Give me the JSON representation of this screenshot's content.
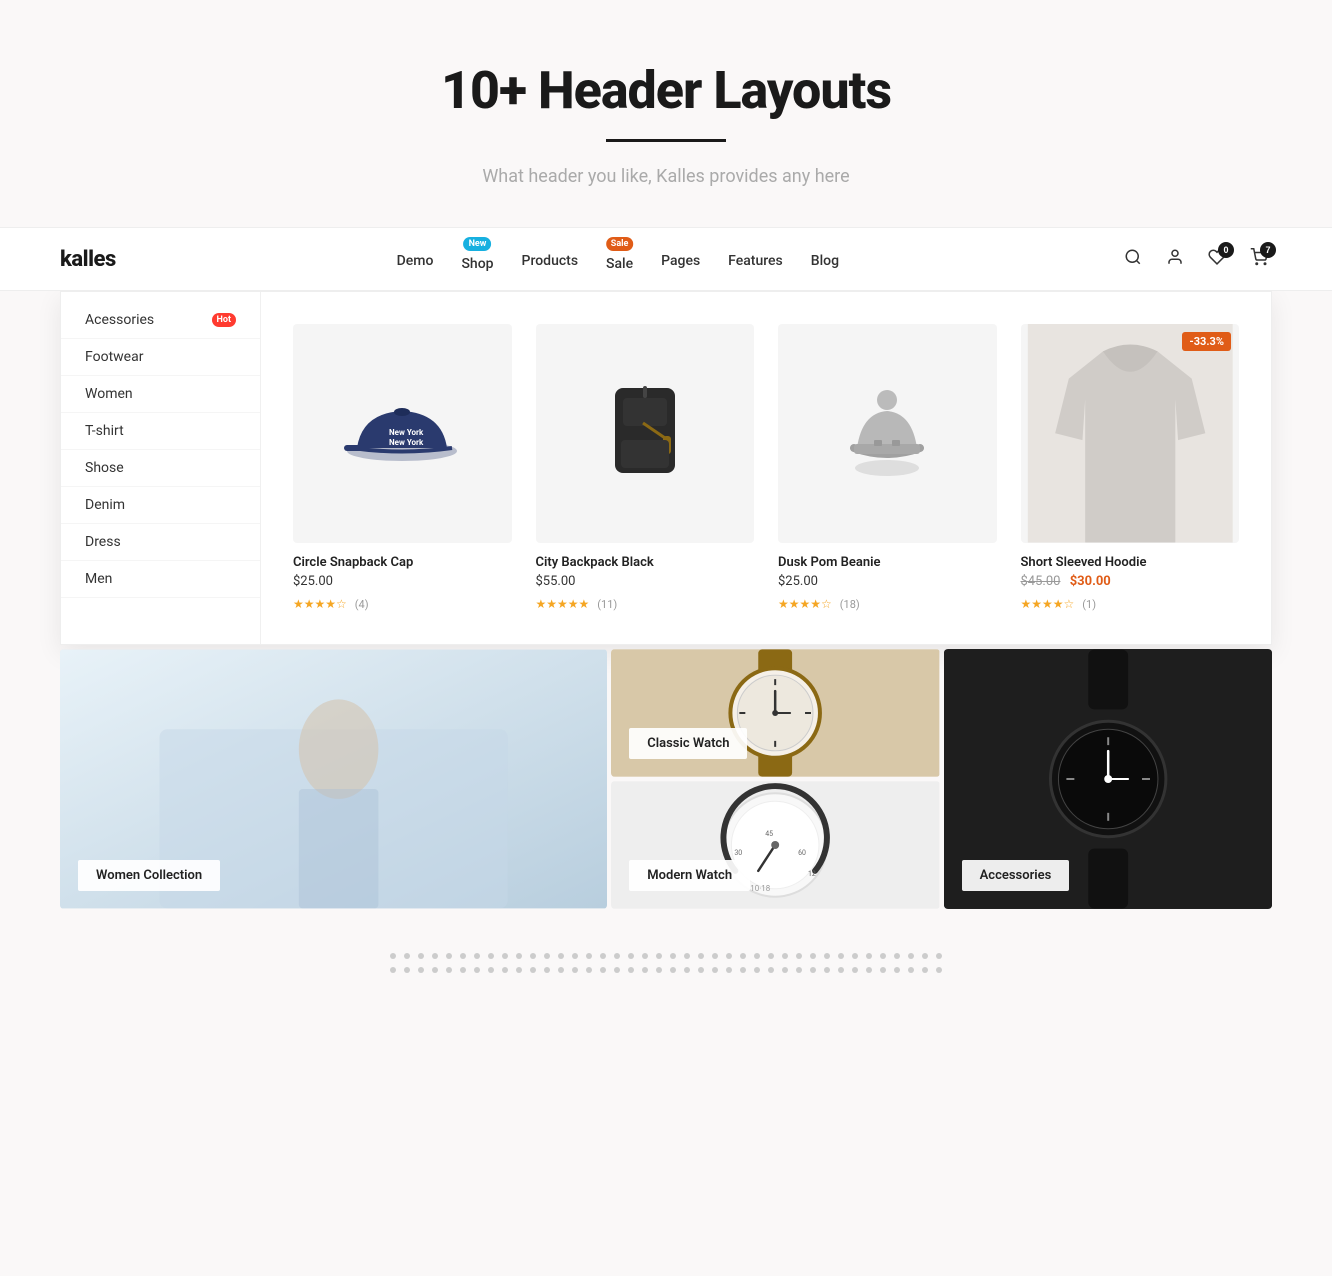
{
  "hero": {
    "title": "10+ Header Layouts",
    "subtitle": "What header you like, Kalles provides any here"
  },
  "header": {
    "logo": "kalles",
    "nav": [
      {
        "label": "Demo",
        "badge": null
      },
      {
        "label": "Shop",
        "badge": "New",
        "badge_type": "new"
      },
      {
        "label": "Products",
        "badge": null
      },
      {
        "label": "Sale",
        "badge": "Sale",
        "badge_type": "sale"
      },
      {
        "label": "Pages",
        "badge": null
      },
      {
        "label": "Features",
        "badge": null
      },
      {
        "label": "Blog",
        "badge": null
      }
    ],
    "cart_count": "7",
    "wishlist_count": "0"
  },
  "categories": [
    {
      "label": "Acessories",
      "badge": "Hot"
    },
    {
      "label": "Footwear",
      "badge": null
    },
    {
      "label": "Women",
      "badge": null
    },
    {
      "label": "T-shirt",
      "badge": null
    },
    {
      "label": "Shose",
      "badge": null
    },
    {
      "label": "Denim",
      "badge": null
    },
    {
      "label": "Dress",
      "badge": null
    },
    {
      "label": "Men",
      "badge": null
    }
  ],
  "products": [
    {
      "name": "Circle Snapback Cap",
      "price": "$25.00",
      "original_price": null,
      "sale_price": null,
      "stars": 4,
      "reviews": 4,
      "discount": null,
      "type": "cap"
    },
    {
      "name": "City Backpack Black",
      "price": "$55.00",
      "original_price": null,
      "sale_price": null,
      "stars": 5,
      "reviews": 11,
      "discount": null,
      "type": "backpack"
    },
    {
      "name": "Dusk Pom Beanie",
      "price": "$25.00",
      "original_price": null,
      "sale_price": null,
      "stars": 4,
      "reviews": 18,
      "discount": null,
      "type": "beanie"
    },
    {
      "name": "Short Sleeved Hoodie",
      "price": "$45.00",
      "original_price": "$45.00",
      "sale_price": "$30.00",
      "stars": 4,
      "reviews": 1,
      "discount": "-33.3%",
      "type": "hoodie"
    }
  ],
  "banners": [
    {
      "label": "Women Collection",
      "type": "women"
    },
    {
      "label": "Classic Watch",
      "type": "classic-watch"
    },
    {
      "label": "Modern Watch",
      "type": "modern-watch"
    },
    {
      "label": "Accessories",
      "type": "accessories"
    }
  ],
  "dots": {
    "rows": 2,
    "cols": 40
  }
}
